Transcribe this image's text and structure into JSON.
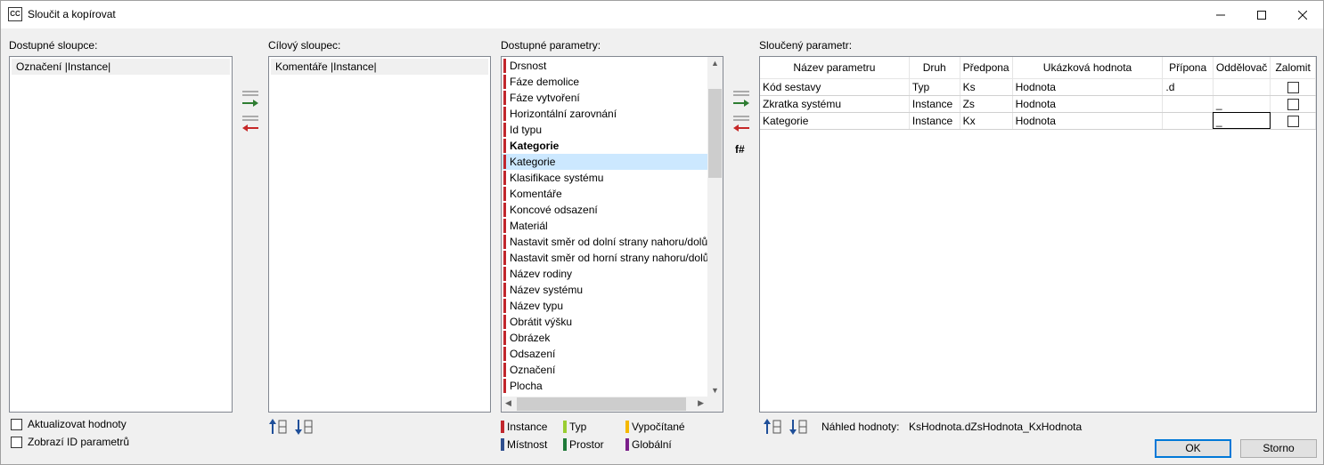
{
  "window": {
    "title": "Sloučit a kopírovat",
    "icon_text": "CC"
  },
  "available_columns": {
    "label": "Dostupné sloupce:",
    "items": [
      "Označení |Instance|"
    ]
  },
  "target_column": {
    "label": "Cílový sloupec:",
    "items": [
      "Komentáře |Instance|"
    ]
  },
  "available_params": {
    "label": "Dostupné parametry:",
    "items": [
      {
        "text": "Drsnost",
        "color": "#c1272d"
      },
      {
        "text": "Fáze demolice",
        "color": "#c1272d"
      },
      {
        "text": "Fáze vytvoření",
        "color": "#c1272d"
      },
      {
        "text": "Horizontální zarovnání",
        "color": "#c1272d"
      },
      {
        "text": "Id typu",
        "color": "#c1272d"
      },
      {
        "text": "Kategorie",
        "color": "#c1272d",
        "bold": true
      },
      {
        "text": "Kategorie",
        "color": "#c1272d",
        "selected": true
      },
      {
        "text": "Klasifikace systému",
        "color": "#c1272d"
      },
      {
        "text": "Komentáře",
        "color": "#c1272d"
      },
      {
        "text": "Koncové odsazení",
        "color": "#c1272d"
      },
      {
        "text": "Materiál",
        "color": "#c1272d"
      },
      {
        "text": "Nastavit směr od dolní strany nahoru/dolů",
        "color": "#c1272d"
      },
      {
        "text": "Nastavit směr od horní strany nahoru/dolů",
        "color": "#c1272d"
      },
      {
        "text": "Název rodiny",
        "color": "#c1272d"
      },
      {
        "text": "Název systému",
        "color": "#c1272d"
      },
      {
        "text": "Název typu",
        "color": "#c1272d"
      },
      {
        "text": "Obrátit výšku",
        "color": "#c1272d"
      },
      {
        "text": "Obrázek",
        "color": "#c1272d"
      },
      {
        "text": "Odsazení",
        "color": "#c1272d"
      },
      {
        "text": "Označení",
        "color": "#c1272d"
      },
      {
        "text": "Plocha",
        "color": "#c1272d"
      }
    ]
  },
  "legend": [
    {
      "label": "Instance",
      "color": "#c1272d"
    },
    {
      "label": "Typ",
      "color": "#9acd32"
    },
    {
      "label": "Vypočítané",
      "color": "#f5b800"
    },
    {
      "label": "Místnost",
      "color": "#2f4f8f"
    },
    {
      "label": "Prostor",
      "color": "#1f7a3a"
    },
    {
      "label": "Globální",
      "color": "#7b1f8a"
    }
  ],
  "merged": {
    "label": "Sloučený parametr:",
    "headers": [
      "Název parametru",
      "Druh",
      "Předpona",
      "Ukázková hodnota",
      "Přípona",
      "Oddělovač",
      "Zalomit"
    ],
    "rows": [
      {
        "name": "Kód sestavy",
        "kind": "Typ",
        "prefix": "Ks",
        "sample": "Hodnota",
        "suffix": ".d",
        "separator": "",
        "wrap": false
      },
      {
        "name": "Zkratka systému",
        "kind": "Instance",
        "prefix": "Zs",
        "sample": "Hodnota",
        "suffix": "",
        "separator": "_",
        "wrap": false
      },
      {
        "name": "Kategorie",
        "kind": "Instance",
        "prefix": "Kx",
        "sample": "Hodnota",
        "suffix": "",
        "separator": "_",
        "wrap": false
      }
    ],
    "formula_label": "f#"
  },
  "checkboxes": {
    "update_values": "Aktualizovat hodnoty",
    "show_param_ids": "Zobrazí ID parametrů"
  },
  "preview": {
    "label": "Náhled hodnoty:",
    "value": "KsHodnota.dZsHodnota_KxHodnota"
  },
  "buttons": {
    "ok": "OK",
    "cancel": "Storno"
  }
}
